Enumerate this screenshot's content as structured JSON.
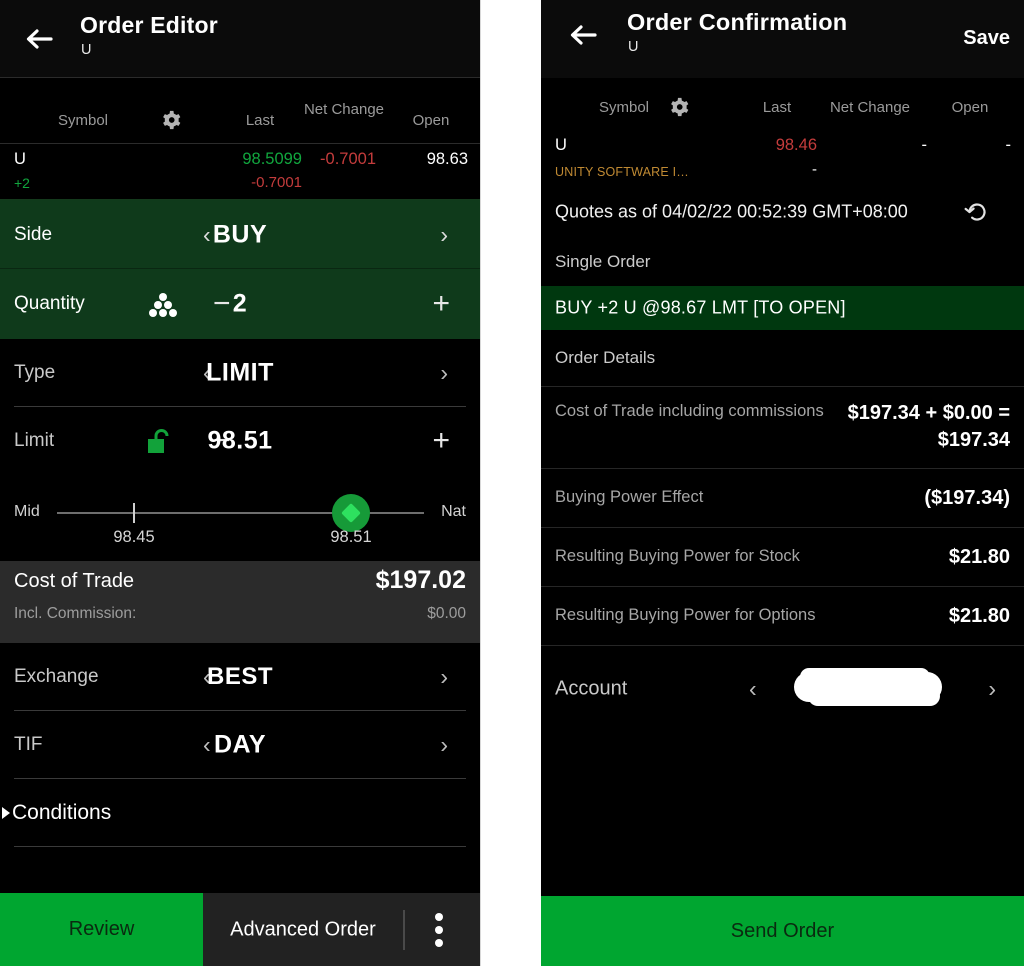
{
  "order_editor": {
    "header": {
      "back_icon": "back-arrow-icon",
      "title": "Order Editor",
      "subtitle": "U"
    },
    "quote_table": {
      "columns": [
        "Symbol",
        "Last",
        "Net Change",
        "Open"
      ],
      "gear_icon": "gear-icon",
      "row": {
        "symbol": "U",
        "position": "+2",
        "last": "98.5099",
        "last_secondary": "-0.7001",
        "net_change": "-0.7001",
        "open": "98.63"
      },
      "colors": {
        "up": "#11a63e",
        "down": "#c43c3c"
      }
    },
    "fields": {
      "side": {
        "label": "Side",
        "value": "BUY",
        "prev_icon": "chevron-left-icon",
        "next_icon": "chevron-right-icon"
      },
      "quantity": {
        "label": "Quantity",
        "value": "2",
        "pyramid_icon": "dot-pyramid-icon",
        "minus": "−",
        "plus": "+"
      },
      "type": {
        "label": "Type",
        "value": "LIMIT",
        "prev_icon": "chevron-left-icon",
        "next_icon": "chevron-right-icon"
      },
      "limit": {
        "label": "Limit",
        "value": "98.51",
        "lock_icon": "unlocked-padlock-icon",
        "minus": "−",
        "plus": "+"
      },
      "exchange": {
        "label": "Exchange",
        "value": "BEST",
        "prev_icon": "chevron-left-icon",
        "next_icon": "chevron-right-icon"
      },
      "tif": {
        "label": "TIF",
        "value": "DAY",
        "prev_icon": "chevron-left-icon",
        "next_icon": "chevron-right-icon"
      }
    },
    "price_slider": {
      "left_label": "Mid",
      "right_label": "Nat",
      "mid_value": "98.45",
      "current_value": "98.51",
      "thumb_percent": 72
    },
    "cost_band": {
      "title": "Cost of Trade",
      "amount": "$197.02",
      "sub_label": "Incl. Commission:",
      "sub_value": "$0.00"
    },
    "conditions": {
      "label": "Conditions",
      "expander_icon": "triangle-right-icon"
    },
    "bottom_bar": {
      "review_label": "Review",
      "advanced_label": "Advanced Order",
      "menu_icon": "kebab-menu-icon",
      "accent": "#00a630"
    }
  },
  "order_confirmation": {
    "header": {
      "back_icon": "back-arrow-icon",
      "title": "Order Confirmation",
      "subtitle": "U",
      "save_label": "Save"
    },
    "quote_table": {
      "columns": [
        "Symbol",
        "Last",
        "Net Change",
        "Open"
      ],
      "gear_icon": "gear-icon",
      "row": {
        "symbol": "U",
        "company": "UNITY SOFTWARE I…",
        "last": "98.46",
        "last_secondary": "-",
        "net_change": "-",
        "open": "-"
      }
    },
    "quotes_timestamp": {
      "text": "Quotes as of 04/02/22 00:52:39 GMT+08:00",
      "refresh_icon": "refresh-icon"
    },
    "single_order_label": "Single Order",
    "order_strip": "BUY +2 U @98.67 LMT [TO OPEN]",
    "order_details_label": "Order Details",
    "details": [
      {
        "key": "Cost of Trade including commissions",
        "value": "$197.34 + $0.00 = $197.34"
      },
      {
        "key": "Buying Power Effect",
        "value": "($197.34)"
      },
      {
        "key": "Resulting Buying Power for Stock",
        "value": "$21.80"
      },
      {
        "key": "Resulting Buying Power for Options",
        "value": "$21.80"
      }
    ],
    "account": {
      "label": "Account",
      "value_redacted": "",
      "prev_icon": "chevron-left-icon",
      "next_icon": "chevron-right-icon"
    },
    "send_button": {
      "label": "Send Order",
      "accent": "#00a630"
    }
  }
}
